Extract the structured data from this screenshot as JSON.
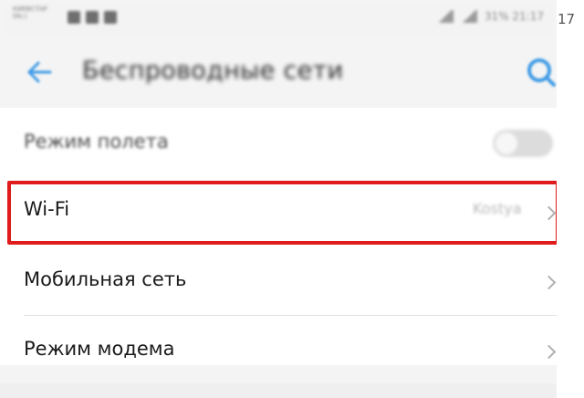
{
  "statusbar": {
    "carrier_line1": "КИЕВСТАР",
    "carrier_line2": "life:)",
    "right_text": "31% 21:17",
    "edge_fragment": "17"
  },
  "toolbar": {
    "title": "Беспроводные сети",
    "back_icon": "arrow-left-icon",
    "search_icon": "search-icon"
  },
  "settings": {
    "airplane": {
      "label": "Режим полета",
      "enabled": false
    },
    "wifi": {
      "label": "Wi-Fi",
      "value": "Kostya"
    },
    "mobile": {
      "label": "Мобильная сеть"
    },
    "modem": {
      "label": "Режим модема"
    }
  },
  "colors": {
    "accent": "#3d9ae6",
    "highlight": "#e01b1b",
    "text": "#1a1a1a",
    "secondary_text": "#b8b8b8"
  }
}
